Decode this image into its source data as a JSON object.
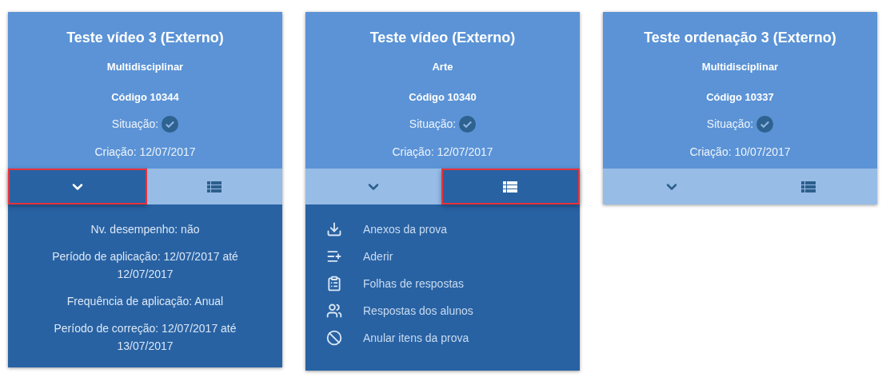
{
  "cards": [
    {
      "title": "Teste vídeo 3 (Externo)",
      "subject": "Multidisciplinar",
      "code": "Código 10344",
      "status_label": "Situação:",
      "creation": "Criação: 12/07/2017",
      "tabs": [
        {
          "kind": "details",
          "selected": true
        },
        {
          "kind": "menu",
          "selected": false
        }
      ],
      "details": [
        "Nv. desempenho: não",
        "Período de aplicação: 12/07/2017 até 12/07/2017",
        "Frequência de aplicação: Anual",
        "Período de correção: 12/07/2017 até 13/07/2017"
      ]
    },
    {
      "title": "Teste vídeo (Externo)",
      "subject": "Arte",
      "code": "Código 10340",
      "status_label": "Situação:",
      "creation": "Criação: 12/07/2017",
      "tabs": [
        {
          "kind": "details",
          "selected": false
        },
        {
          "kind": "menu",
          "selected": true
        }
      ],
      "menu": [
        {
          "kind": "download",
          "label": "Anexos da prova"
        },
        {
          "kind": "add",
          "label": "Aderir"
        },
        {
          "kind": "clipboard",
          "label": "Folhas de respostas"
        },
        {
          "kind": "people",
          "label": "Respostas dos alunos"
        },
        {
          "kind": "cancel",
          "label": "Anular itens da prova"
        }
      ]
    },
    {
      "title": "Teste ordenação 3 (Externo)",
      "subject": "Multidisciplinar",
      "code": "Código 10337",
      "status_label": "Situação:",
      "creation": "Criação: 10/07/2017",
      "tabs": [
        {
          "kind": "details",
          "selected": false
        },
        {
          "kind": "menu",
          "selected": false
        }
      ]
    }
  ]
}
